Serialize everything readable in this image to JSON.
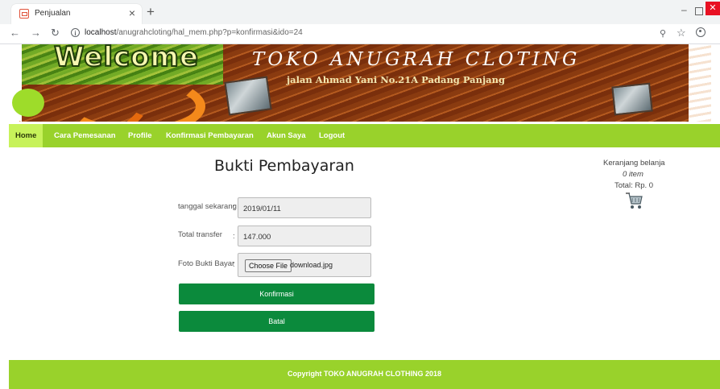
{
  "browser": {
    "tab_title": "Penjualan",
    "tab_close": "×",
    "new_tab": "+",
    "url_host": "localhost",
    "url_path": "/anugrahcloting/hal_mem.php?p=konfirmasi&ido=24",
    "window_min": "‒",
    "window_close": "✕"
  },
  "banner": {
    "welcome": "Welcome",
    "title": "TOKO ANUGRAH CLOTING",
    "address": "jalan Ahmad Yani No.21A Padang Panjang"
  },
  "menu": {
    "items": [
      {
        "label": "Home"
      },
      {
        "label": "Cara Pemesanan"
      },
      {
        "label": "Profile"
      },
      {
        "label": "Konfirmasi Pembayaran"
      },
      {
        "label": "Akun Saya"
      },
      {
        "label": "Logout"
      }
    ],
    "active_index": 0
  },
  "form": {
    "title": "Bukti Pembayaran",
    "date_label": "tanggal sekarang",
    "date_value": "2019/01/11",
    "transfer_label": "Total transfer",
    "transfer_value": "147.000",
    "photo_label": "Foto Bukti Bayar",
    "choose_file": "Choose File",
    "file_name": "download.jpg",
    "colon": ":",
    "confirm_button": "Konfirmasi",
    "cancel_button": "Batal"
  },
  "cart": {
    "title": "Keranjang belanja",
    "items": "0 item",
    "total": "Total: Rp. 0"
  },
  "footer": {
    "copyright": "Copyright TOKO ANUGRAH CLOTHING 2018"
  },
  "colors": {
    "menu_bar": "#99d22b",
    "active_menu": "#c7f25a",
    "button": "#0b8a3c"
  }
}
